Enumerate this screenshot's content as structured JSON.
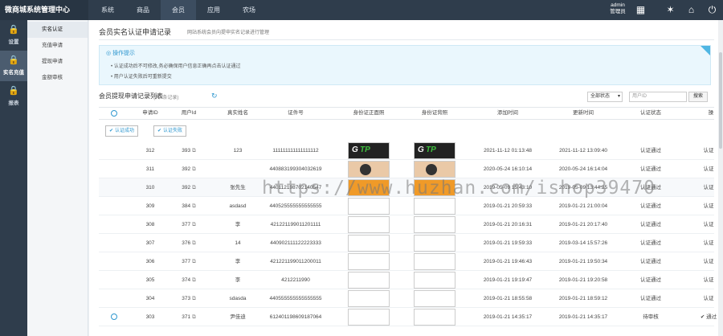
{
  "app": {
    "title": "微商城系统管理中心"
  },
  "topnav": {
    "items": [
      {
        "label": "系统",
        "active": false
      },
      {
        "label": "商品",
        "active": false
      },
      {
        "label": "会员",
        "active": false
      },
      {
        "label": "应用",
        "active": false
      },
      {
        "label": "农场",
        "active": false
      }
    ]
  },
  "user": {
    "name": "admin",
    "role": "管理员"
  },
  "icons": {
    "top": [
      "card-icon",
      "network-icon",
      "home-icon",
      "power-icon"
    ]
  },
  "leftnav": {
    "items": [
      {
        "label": "设置",
        "icon": "lock-icon",
        "active": false
      },
      {
        "label": "实名充值",
        "icon": "lock-icon",
        "active": true
      },
      {
        "label": "报表",
        "icon": "lock-icon",
        "active": false
      }
    ]
  },
  "subnav": {
    "items": [
      {
        "label": "实名认证",
        "active": true
      },
      {
        "label": "充值申请",
        "active": false
      },
      {
        "label": "提现申请",
        "active": false
      },
      {
        "label": "金额审核",
        "active": false
      }
    ]
  },
  "page": {
    "title": "会员实名认证申请记录",
    "desc": "网站系统会员向提申实名记录进行管理"
  },
  "tips": {
    "heading": "操作提示",
    "lines": [
      "认证成功后不可修改,务必确保用户信息正确再点击认证通过",
      "用户认证失败后可重新提交"
    ]
  },
  "list": {
    "title": "会员提现申请记录列表",
    "count": "(共0条记录)",
    "status_select": "全部状态",
    "search_placeholder": "用户ID",
    "search_button": "搜索",
    "columns": [
      "申请ID",
      "用户Id",
      "真实姓名",
      "证件号",
      "身份证正面照",
      "身份证背照",
      "添加时间",
      "更新时间",
      "认证状态",
      "操"
    ],
    "btn_success": "认证成功",
    "btn_fail": "认证失败",
    "rows": [
      {
        "id": "312",
        "uid": "393",
        "name": "123",
        "idno": "111111111111111112",
        "img": "gtp",
        "add": "2021-11-12 01:13:48",
        "upd": "2021-11-12 13:09:40",
        "status": "认证通过",
        "op": "认证"
      },
      {
        "id": "311",
        "uid": "392",
        "name": "",
        "idno": "440883199304032619",
        "img": "photo",
        "add": "2020-05-24 16:10:14",
        "upd": "2020-05-24 16:14:04",
        "status": "认证通过",
        "op": "认证"
      },
      {
        "id": "310",
        "uid": "392",
        "name": "张先生",
        "idno": "440112198702140547",
        "img": "orange",
        "add": "2019-05-09 15:43:10",
        "upd": "2019-05-09 13:44:25",
        "status": "认证通过",
        "op": "认证"
      },
      {
        "id": "309",
        "uid": "384",
        "name": "asdasd",
        "idno": "440525555555555555",
        "img": "blank",
        "add": "2019-01-21 20:59:33",
        "upd": "2019-01-21 21:00:04",
        "status": "认证通过",
        "op": "认证"
      },
      {
        "id": "308",
        "uid": "377",
        "name": "李",
        "idno": "421221199011201111",
        "img": "blank",
        "add": "2019-01-21 20:16:31",
        "upd": "2019-01-21 20:17:40",
        "status": "认证通过",
        "op": "认证"
      },
      {
        "id": "307",
        "uid": "376",
        "name": "14",
        "idno": "440902111122223333",
        "img": "blank",
        "add": "2019-01-21 19:59:33",
        "upd": "2019-03-14 15:57:26",
        "status": "认证通过",
        "op": "认证"
      },
      {
        "id": "306",
        "uid": "377",
        "name": "李",
        "idno": "421221199011200011",
        "img": "blank",
        "add": "2019-01-21 19:46:43",
        "upd": "2019-01-21 19:50:34",
        "status": "认证通过",
        "op": "认证"
      },
      {
        "id": "305",
        "uid": "374",
        "name": "李",
        "idno": "4212211990",
        "img": "blank",
        "add": "2019-01-21 19:19:47",
        "upd": "2019-01-21 19:20:58",
        "status": "认证通过",
        "op": "认证"
      },
      {
        "id": "304",
        "uid": "373",
        "name": "sdasda",
        "idno": "440555555555555555",
        "img": "blank",
        "add": "2019-01-21 18:55:58",
        "upd": "2019-01-21 18:59:12",
        "status": "认证通过",
        "op": "认证"
      },
      {
        "id": "303",
        "uid": "371",
        "name": "尹佳迪",
        "idno": "612401198609187064",
        "img": "blank",
        "add": "2019-01-21 14:35:17",
        "upd": "2019-01-21 14:35:17",
        "status": "待审核",
        "op": "通过"
      }
    ]
  },
  "watermark": "https://www.huzhan.com/ishop39470",
  "colors": {
    "topbar": "#2f3d4c",
    "accent": "#2e97cf",
    "tips_bg": "#eaf7fd"
  }
}
